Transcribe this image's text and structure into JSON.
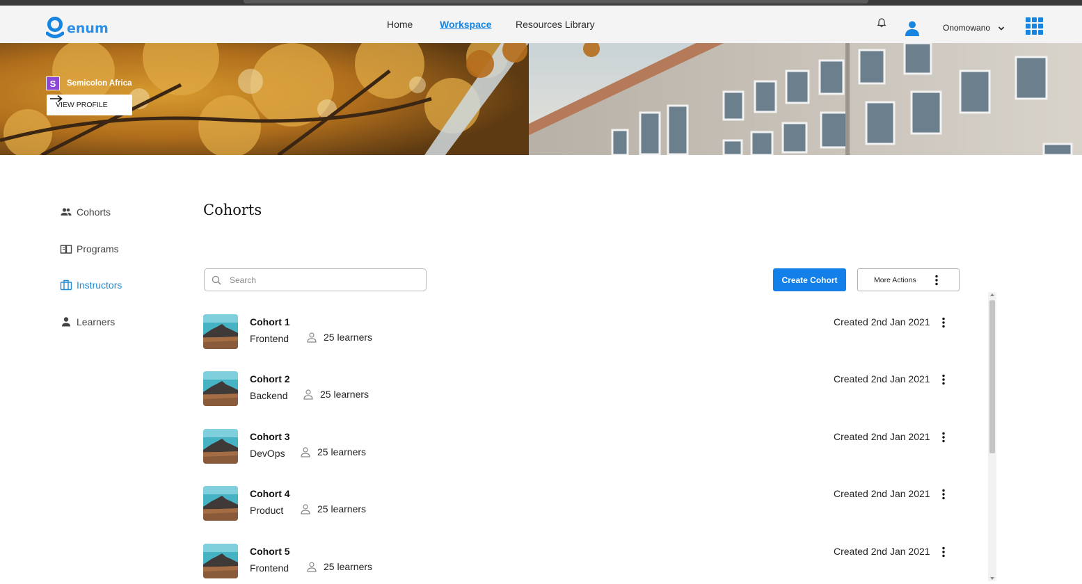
{
  "app": {
    "logo_text": "enum",
    "brand_color": "#1785e0"
  },
  "nav": {
    "links": [
      {
        "label": "Home",
        "active": false
      },
      {
        "label": "Workspace",
        "active": true
      },
      {
        "label": "Resources Library",
        "active": false
      }
    ],
    "username": "Onomowano",
    "icons": [
      "bell-icon",
      "user-avatar-icon",
      "chevron-down-icon",
      "apps-grid-icon"
    ]
  },
  "banner": {
    "org_initial": "S",
    "org_name": "Semicolon Africa",
    "view_profile_label": "VIEW PROFILE"
  },
  "sidebar": {
    "items": [
      {
        "label": "Cohorts",
        "icon": "people-icon",
        "active": false
      },
      {
        "label": "Programs",
        "icon": "book-icon",
        "active": false
      },
      {
        "label": "Instructors",
        "icon": "briefcase-icon",
        "active": true
      },
      {
        "label": "Learners",
        "icon": "person-icon",
        "active": false
      }
    ]
  },
  "main": {
    "title": "Cohorts",
    "search_placeholder": "Search",
    "create_label": "Create Cohort",
    "more_actions_label": "More Actions",
    "cohorts": [
      {
        "name": "Cohort 1",
        "track": "Frontend",
        "learners": "25 learners",
        "created": "Created 2nd Jan 2021"
      },
      {
        "name": "Cohort 2",
        "track": "Backend",
        "learners": "25 learners",
        "created": "Created 2nd Jan 2021"
      },
      {
        "name": "Cohort 3",
        "track": "DevOps",
        "learners": "25 learners",
        "created": "Created 2nd Jan 2021"
      },
      {
        "name": "Cohort 4",
        "track": "Product",
        "learners": "25 learners",
        "created": "Created 2nd Jan 2021"
      },
      {
        "name": "Cohort 5",
        "track": "Frontend",
        "learners": "25 learners",
        "created": "Created 2nd Jan 2021"
      }
    ]
  }
}
